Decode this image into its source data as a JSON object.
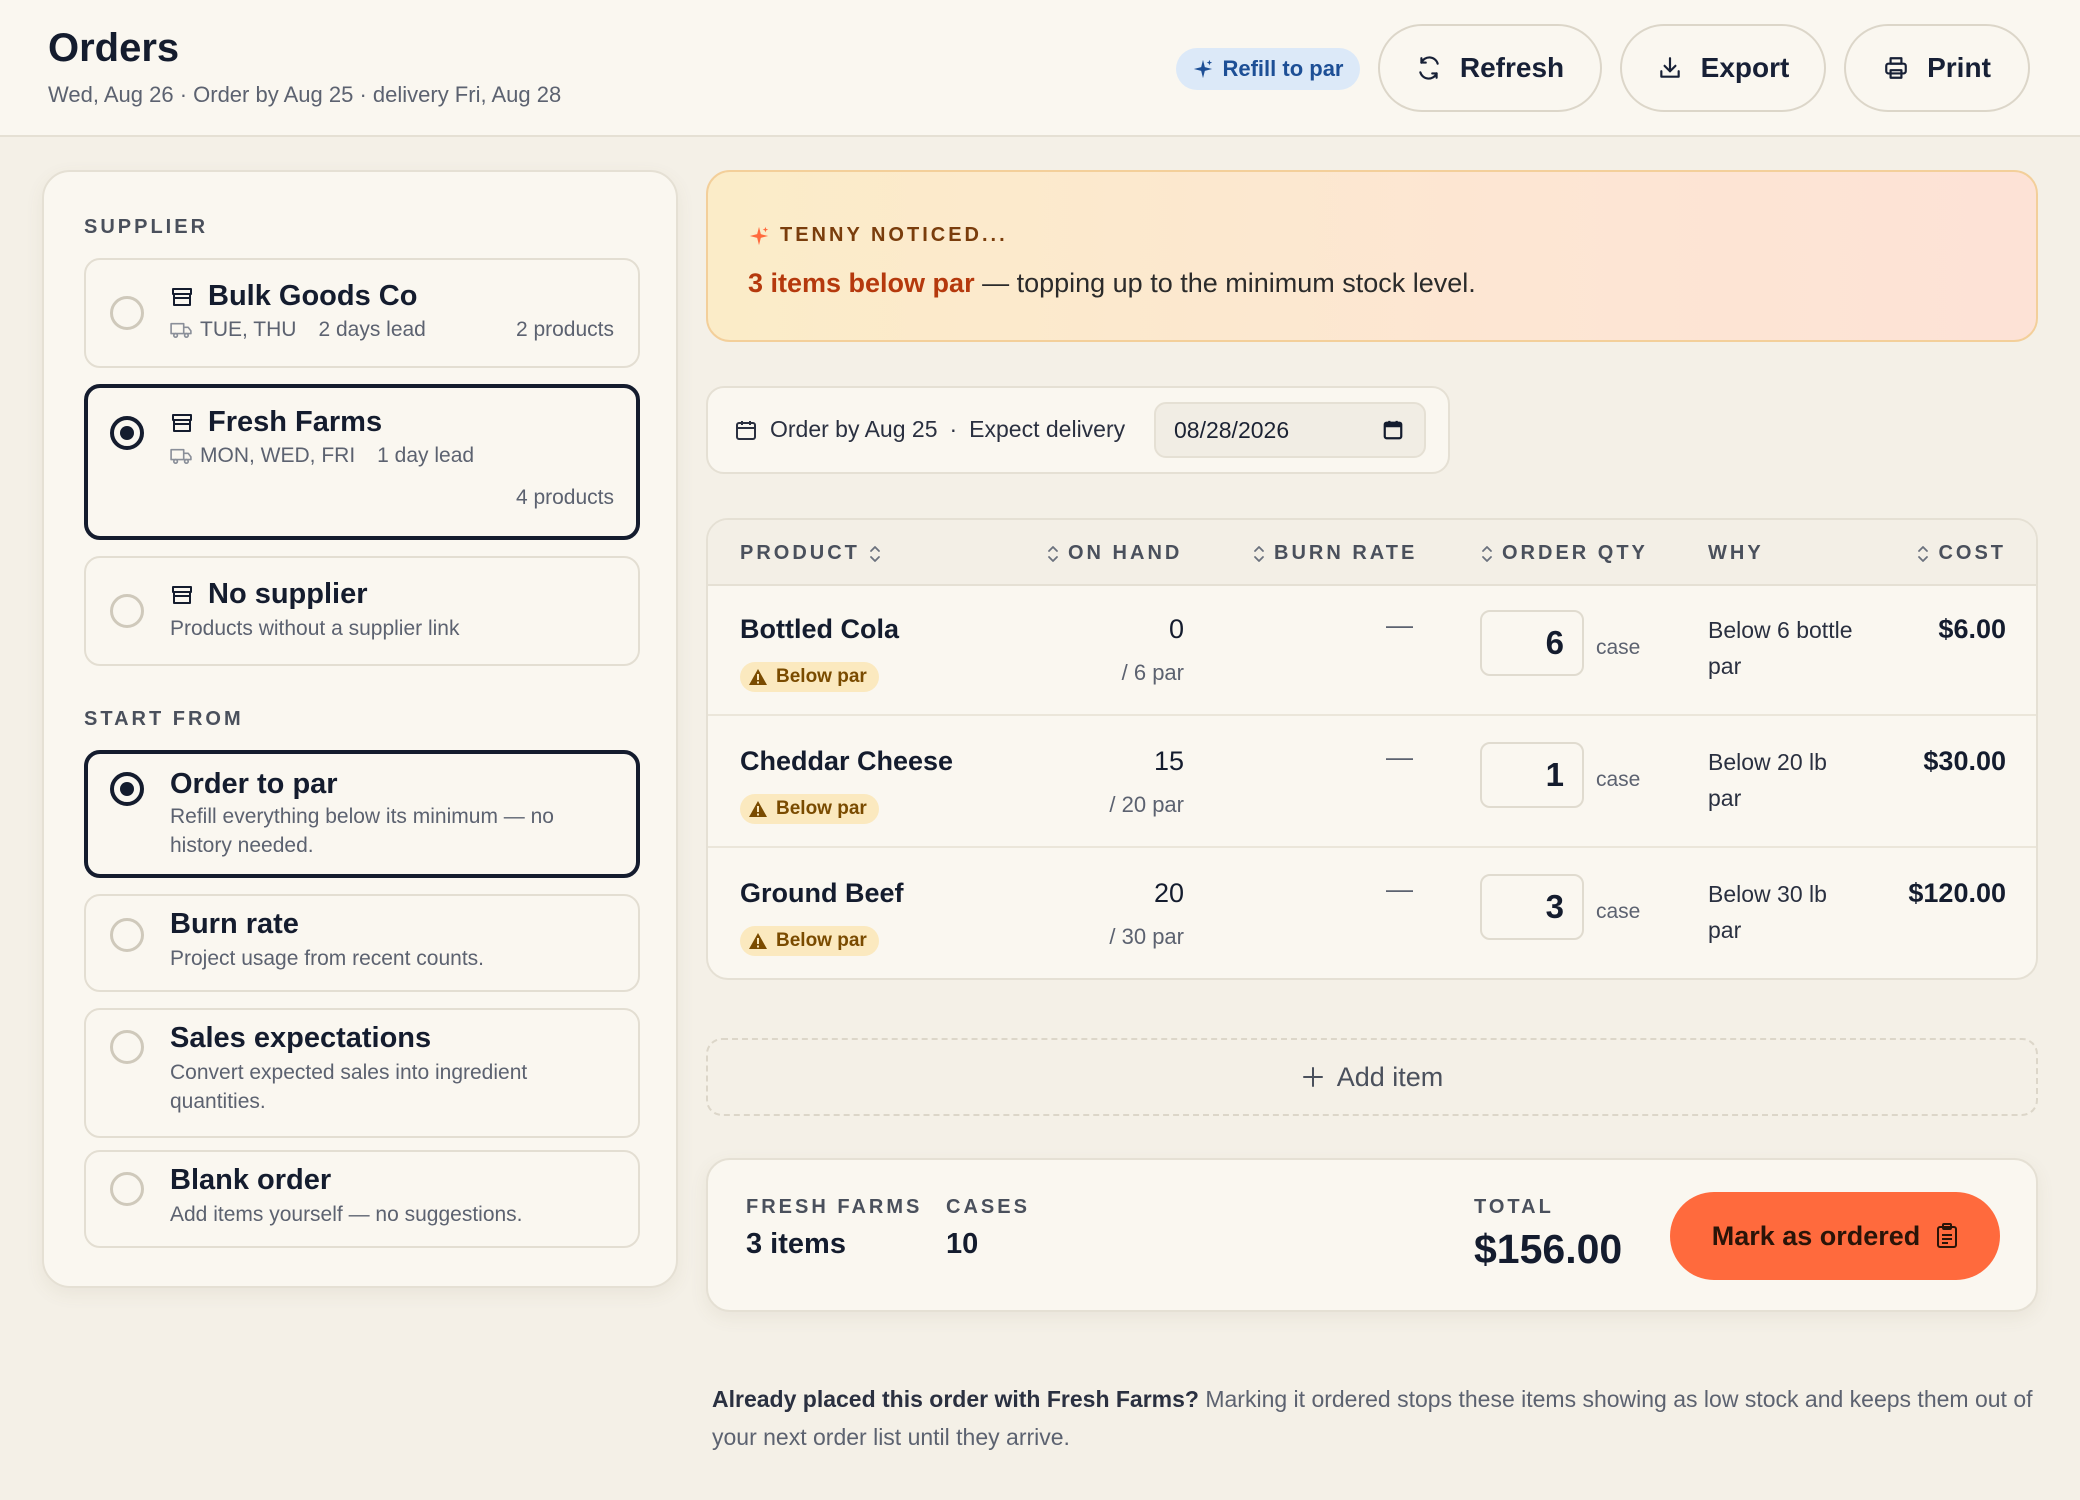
{
  "header": {
    "title": "Orders",
    "subtitle": "Wed, Aug 26 · Order by Aug 25 · delivery Fri, Aug 28",
    "refill_pill": "Refill to par",
    "refresh": "Refresh",
    "export": "Export",
    "print": "Print"
  },
  "sidebar": {
    "supplier_label": "SUPPLIER",
    "suppliers": [
      {
        "name": "Bulk Goods Co",
        "days": "TUE, THU",
        "lead": "2 days lead",
        "count": "2 products",
        "selected": false
      },
      {
        "name": "Fresh Farms",
        "days": "MON, WED, FRI",
        "lead": "1 day lead",
        "count": "4 products",
        "selected": true
      },
      {
        "name": "No supplier",
        "desc": "Products without a supplier link",
        "selected": false
      }
    ],
    "start_label": "START FROM",
    "starts": [
      {
        "title": "Order to par",
        "desc": "Refill everything below its minimum — no history needed.",
        "selected": true
      },
      {
        "title": "Burn rate",
        "desc": "Project usage from recent counts.",
        "selected": false
      },
      {
        "title": "Sales expectations",
        "desc": "Convert expected sales into ingredient quantities.",
        "selected": false
      },
      {
        "title": "Blank order",
        "desc": "Add items yourself — no suggestions.",
        "selected": false
      }
    ]
  },
  "notice": {
    "label": "TENNY NOTICED...",
    "strong": "3 items below par",
    "rest": " — topping up to the minimum stock level."
  },
  "datebar": {
    "order_by": "Order by Aug 25",
    "sep": "·",
    "expect": "Expect delivery",
    "date_value": "08/28/2026"
  },
  "table": {
    "columns": [
      "PRODUCT",
      "ON HAND",
      "BURN RATE",
      "ORDER QTY",
      "WHY",
      "COST"
    ],
    "rows": [
      {
        "product": "Bottled Cola",
        "badge": "Below par",
        "on_hand": "0",
        "par": "/ 6 par",
        "burn": "—",
        "qty": "6",
        "unit": "case",
        "why": "Below 6 bottle par",
        "cost": "$6.00"
      },
      {
        "product": "Cheddar Cheese",
        "badge": "Below par",
        "on_hand": "15",
        "par": "/ 20 par",
        "burn": "—",
        "qty": "1",
        "unit": "case",
        "why": "Below 20 lb par",
        "cost": "$30.00"
      },
      {
        "product": "Ground Beef",
        "badge": "Below par",
        "on_hand": "20",
        "par": "/ 30 par",
        "burn": "—",
        "qty": "3",
        "unit": "case",
        "why": "Below 30 lb par",
        "cost": "$120.00"
      }
    ]
  },
  "add_item": "Add item",
  "summary": {
    "supplier_label": "FRESH FARMS",
    "items": "3 items",
    "cases_label": "CASES",
    "cases": "10",
    "total_label": "TOTAL",
    "total": "$156.00",
    "mark_button": "Mark as ordered"
  },
  "bottom_note": {
    "strong": "Already placed this order with Fresh Farms?",
    "rest": " Marking it ordered stops these items showing as low stock and keeps them out of your next order list until they arrive."
  },
  "colors": {
    "accent": "#ff6a3d",
    "ink": "#141c2e",
    "badge_bg": "#fbe9bf",
    "notice_strong": "#b5390d",
    "pill_bg": "#dce9f8"
  },
  "icons": {
    "refill": "sparkle-icon",
    "refresh": "refresh-icon",
    "export": "download-icon",
    "print": "printer-icon",
    "supplier": "store-icon",
    "delivery": "truck-icon",
    "notice": "sparkle-icon",
    "calendar": "calendar-icon",
    "sort": "sort-icon",
    "warning": "warning-icon",
    "add": "plus-icon",
    "mark": "clipboard-icon"
  }
}
